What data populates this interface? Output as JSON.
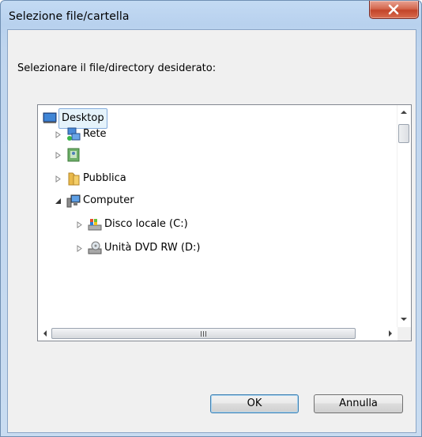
{
  "window": {
    "title": "Selezione file/cartella",
    "close_symbol": "X"
  },
  "prompt": "Selezionare il file/directory desiderato:",
  "tree": {
    "items": [
      {
        "label": "Desktop",
        "icon": "desktop-icon",
        "expander": "none",
        "selected": true
      },
      {
        "label": "Rete",
        "icon": "network-icon",
        "expander": "collapsed"
      },
      {
        "label": "",
        "icon": "user-folder-icon",
        "expander": "collapsed"
      },
      {
        "label": "Pubblica",
        "icon": "folder-icon",
        "expander": "collapsed"
      },
      {
        "label": "Computer",
        "icon": "computer-icon",
        "expander": "expanded"
      },
      {
        "label": "Disco locale (C:)",
        "icon": "hard-drive-icon",
        "expander": "collapsed"
      },
      {
        "label": "Unità DVD RW (D:)",
        "icon": "dvd-drive-icon",
        "expander": "collapsed"
      }
    ]
  },
  "buttons": {
    "ok": "OK",
    "cancel": "Annulla"
  },
  "colors": {
    "selection_bg": "#e5f3fb",
    "selection_border": "#84acdd",
    "close_button": "#c2442a"
  }
}
